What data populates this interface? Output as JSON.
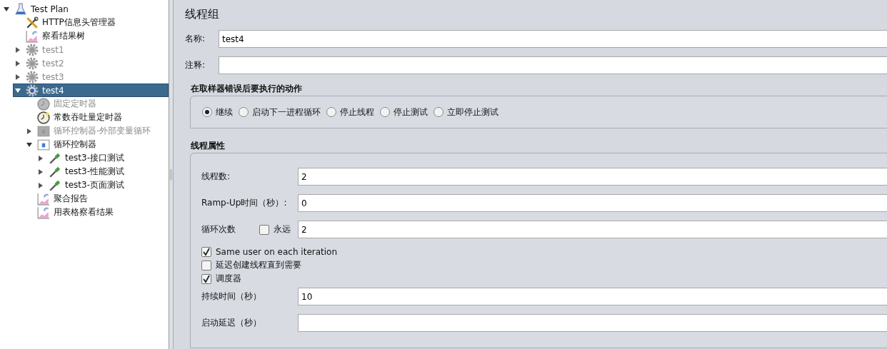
{
  "tree": [
    {
      "label": "Test Plan",
      "kind": "flask",
      "expanded": true,
      "selected": false,
      "disabled": false,
      "children": [
        {
          "label": "HTTP信息头管理器",
          "kind": "tools",
          "selected": false,
          "disabled": false
        },
        {
          "label": "察看结果树",
          "kind": "graph",
          "selected": false,
          "disabled": false
        },
        {
          "label": "test1",
          "kind": "gear",
          "expanded": false,
          "selected": false,
          "disabled": true
        },
        {
          "label": "test2",
          "kind": "gear",
          "expanded": false,
          "selected": false,
          "disabled": true
        },
        {
          "label": "test3",
          "kind": "gear",
          "expanded": false,
          "selected": false,
          "disabled": true
        },
        {
          "label": "test4",
          "kind": "gear",
          "expanded": true,
          "selected": true,
          "disabled": false,
          "children": [
            {
              "label": "固定定时器",
              "kind": "timer",
              "selected": false,
              "disabled": true
            },
            {
              "label": "常数吞吐量定时器",
              "kind": "timer",
              "selected": false,
              "disabled": false
            },
            {
              "label": "循环控制器-外部变量循环",
              "kind": "loop",
              "expanded": false,
              "selected": false,
              "disabled": true
            },
            {
              "label": "循环控制器",
              "kind": "loop",
              "expanded": true,
              "selected": false,
              "disabled": false,
              "children": [
                {
                  "label": "test3-接口测试",
                  "kind": "dropper",
                  "expanded": false,
                  "selected": false,
                  "disabled": false
                },
                {
                  "label": "test3-性能测试",
                  "kind": "dropper",
                  "expanded": false,
                  "selected": false,
                  "disabled": false
                },
                {
                  "label": "test3-页面测试",
                  "kind": "dropper",
                  "expanded": false,
                  "selected": false,
                  "disabled": false
                }
              ]
            },
            {
              "label": "聚合报告",
              "kind": "graph",
              "selected": false,
              "disabled": false
            },
            {
              "label": "用表格察看结果",
              "kind": "graph",
              "selected": false,
              "disabled": false
            }
          ]
        }
      ]
    }
  ],
  "panel": {
    "title": "线程组",
    "fields": [
      {
        "label": "名称:",
        "value": "test4"
      },
      {
        "label": "注释:"
      }
    ],
    "error_action": {
      "title": "在取样器错误后要执行的动作",
      "options": [
        {
          "label": "继续",
          "selected": true
        },
        {
          "label": "启动下一进程循环",
          "selected": false
        },
        {
          "label": "停止线程",
          "selected": false
        },
        {
          "label": "停止测试",
          "selected": false
        },
        {
          "label": "立即停止测试",
          "selected": false
        }
      ]
    },
    "thread_props": {
      "title": "线程属性",
      "rows": [
        {
          "kind": "field",
          "label": "线程数:",
          "value": "2"
        },
        {
          "kind": "field",
          "label": "Ramp-Up时间（秒）:",
          "value": "0"
        },
        {
          "kind": "loop",
          "label": "循环次数",
          "checkbox_label": "永远",
          "checked": false,
          "value": "2"
        },
        {
          "kind": "check",
          "label": "Same user on each iteration",
          "checked": true
        },
        {
          "kind": "check",
          "label": "延迟创建线程直到需要",
          "checked": false
        },
        {
          "kind": "check",
          "label": "调度器",
          "checked": true
        },
        {
          "kind": "field",
          "label": "持续时间（秒）",
          "value": "10"
        },
        {
          "kind": "field",
          "label": "启动延迟（秒）"
        }
      ]
    }
  }
}
